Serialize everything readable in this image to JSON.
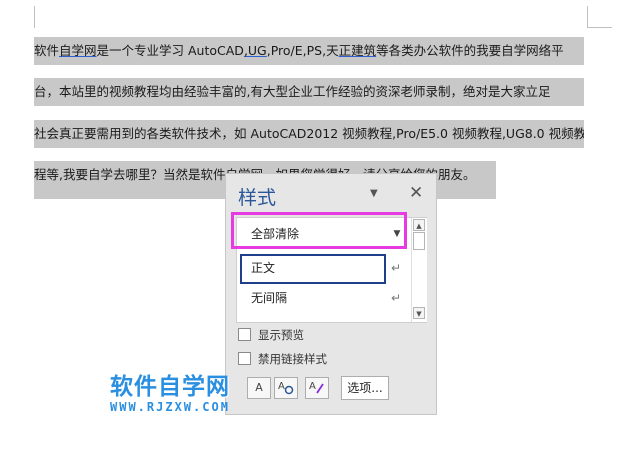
{
  "document": {
    "lines": [
      [
        {
          "text": "软件",
          "underline": false
        },
        {
          "text": "自学网",
          "underline": true
        },
        {
          "text": "是一个专业学习 AutoCAD ",
          "underline": false
        },
        {
          "text": ",UG",
          "underline": true
        },
        {
          "text": ",Pro/E,PS,天",
          "underline": false
        },
        {
          "text": "正建筑",
          "underline": true
        },
        {
          "text": "等各类办公软件的我要自学网络平",
          "underline": false
        }
      ],
      [
        {
          "text": "台，本站里的视频教程均由经验丰富的,有大型企业工作经验的资深老师录制，绝对是大家立足",
          "underline": false
        }
      ],
      [
        {
          "text": "社会真正要需用到的各类软件技术，如 AutoCAD2012 视频教程,Pro/E5.0 视频教程,UG8.0 视频教",
          "underline": false
        }
      ],
      [
        {
          "text": "程等,我要自学去哪里？当然是软件自学网，如果您觉得好，请分享给您的朋友。",
          "underline": false
        }
      ]
    ]
  },
  "styles_pane": {
    "title": "样式",
    "menu_icon": "dropdown-triangle",
    "close_icon": "close-x",
    "items": [
      {
        "label": "全部清除",
        "mark": "",
        "has_dropdown": true
      },
      {
        "label": "正文",
        "mark": "↵",
        "has_dropdown": false
      },
      {
        "label": "无间隔",
        "mark": "↵",
        "has_dropdown": false
      }
    ],
    "show_preview_label": "显示预览",
    "disable_linked_label": "禁用链接样式",
    "options_label": "选项..."
  },
  "watermark": {
    "title": "软件自学网",
    "url": "WWW.RJZXW.COM"
  },
  "colors": {
    "accent": "#2b579a",
    "highlight_magenta": "#e63be0",
    "highlight_blue": "#1f3f8a",
    "selection": "#c8c8c8",
    "watermark": "#2a8fe0"
  }
}
